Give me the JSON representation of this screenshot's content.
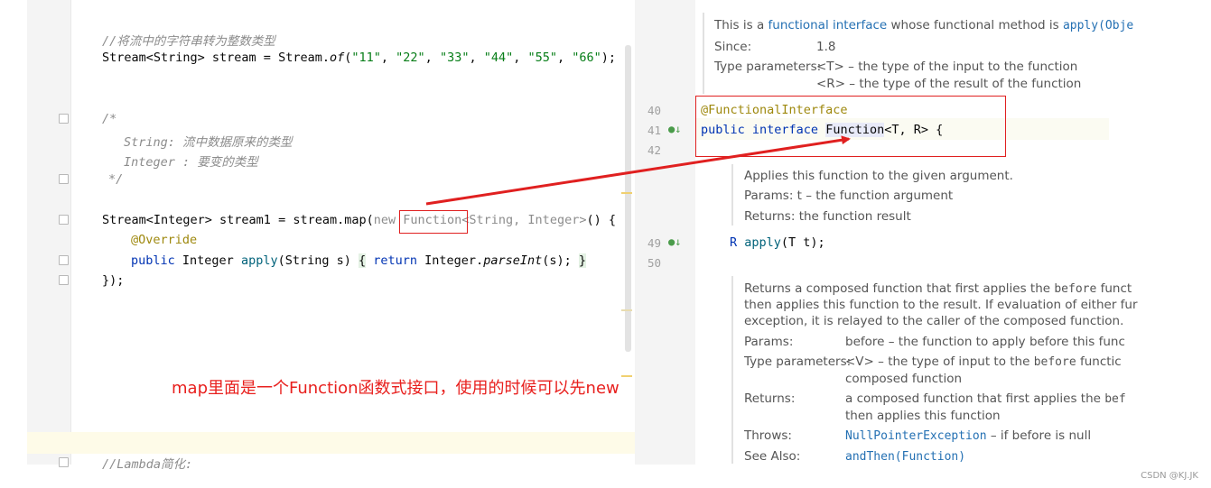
{
  "left_code": {
    "line1": "//将流中的字符串转为整数类型",
    "line2_a": "Stream<String> stream = Stream.",
    "line2_of": "of",
    "line2_b": "(",
    "line2_strings": [
      "\"11\"",
      "\"22\"",
      "\"33\"",
      "\"44\"",
      "\"55\"",
      "\"66\""
    ],
    "line2_c": ");",
    "line3": "/*",
    "line4_type": "String:",
    "line4_desc": " 流中数据原来的类型",
    "line5_type": "Integer :",
    "line5_desc": " 要变的类型",
    "line6": "*/",
    "line7_a": "Stream<Integer> stream1 = stream.map(",
    "line7_new": "new ",
    "line7_function": "Function",
    "line7_generic": "<String, Integer>",
    "line7_b": "() {",
    "line8": "@Override",
    "line9_public": "public ",
    "line9_type": "Integer ",
    "line9_method": "apply",
    "line9_params": "(String s) ",
    "line9_open": "{",
    "line9_return": " return ",
    "line9_call_a": "Integer.",
    "line9_call_m": "parseInt",
    "line9_call_b": "(s); ",
    "line9_close": "}",
    "line10": "});",
    "line11": "//Lambda简化:"
  },
  "annotation": "map里面是一个Function函数式接口，使用的时候可以先new",
  "right_code": {
    "doc_top_a": "This is a ",
    "doc_top_link": "functional interface",
    "doc_top_b": " whose functional method is ",
    "doc_top_code": "apply(Obje",
    "since_label": "Since:",
    "since_value": "1.8",
    "type_params_label": "Type parameters:",
    "type_param_t": "<T> – the type of the input to the function",
    "type_param_r": "<R> – the type of the result of the function",
    "line_40": "40",
    "line_41": "41",
    "line_42": "42",
    "line_49": "49",
    "line_50": "50",
    "annotation_code": "@FunctionalInterface",
    "decl_public": "public ",
    "decl_interface": "interface ",
    "decl_name": "Function",
    "decl_rest": "<T, R> {",
    "apply_doc_1": "Applies this function to the given argument.",
    "apply_params_label": "Params:",
    "apply_params_value": "t – the function argument",
    "apply_returns_label": "Returns:",
    "apply_returns_value": "the function result",
    "apply_sig_r": "R ",
    "apply_sig_name": "apply",
    "apply_sig_rest": "(T t);",
    "compose_doc_1a": "Returns a composed function that first applies the ",
    "compose_doc_1code": "before",
    "compose_doc_1b": " funct",
    "compose_doc_2": "then applies this function to the result. If evaluation of either fur",
    "compose_doc_3": "exception, it is relayed to the caller of the composed function.",
    "compose_params_label": "Params:",
    "compose_params_value": "before – the function to apply before this func",
    "compose_type_label": "Type parameters:",
    "compose_type_value_a": "<V> – the type of input to the ",
    "compose_type_value_code": "before",
    "compose_type_value_b": " functic",
    "compose_type_value_2": "composed function",
    "compose_returns_label": "Returns:",
    "compose_returns_value_a": "a composed function that first applies the ",
    "compose_returns_value_code": "bef",
    "compose_returns_value_2": "then applies this function",
    "compose_throws_label": "Throws:",
    "compose_throws_code": "NullPointerException",
    "compose_throws_rest": " – if before is null",
    "compose_see_label": "See Also:",
    "compose_see_code": "andThen(Function)"
  },
  "watermark": "CSDN @KJ.JK"
}
